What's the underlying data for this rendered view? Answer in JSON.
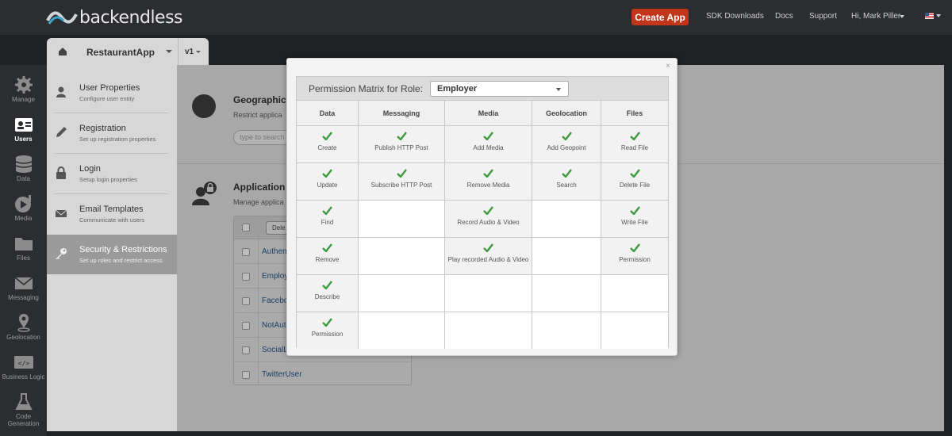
{
  "topbar": {
    "brand": "backendless",
    "create_app": "Create App",
    "links": [
      "SDK Downloads",
      "Docs",
      "Support",
      "Hi, Mark Piller"
    ],
    "accent": "#c3351b"
  },
  "app_selector": {
    "app_name": "RestaurantApp",
    "version": "v1"
  },
  "left_nav": [
    {
      "label": "Manage",
      "icon": "gear-icon"
    },
    {
      "label": "Users",
      "icon": "users-icon",
      "active": true
    },
    {
      "label": "Data",
      "icon": "database-icon"
    },
    {
      "label": "Media",
      "icon": "media-icon"
    },
    {
      "label": "Files",
      "icon": "folder-icon"
    },
    {
      "label": "Messaging",
      "icon": "envelope-icon"
    },
    {
      "label": "Geolocation",
      "icon": "location-pin-icon"
    },
    {
      "label": "Business Logic",
      "icon": "code-icon"
    },
    {
      "label": "Code Generation",
      "icon": "flask-icon"
    }
  ],
  "user_menu": [
    {
      "title": "User Properties",
      "desc": "Configure user entity",
      "icon": "user-icon"
    },
    {
      "title": "Registration",
      "desc": "Set up registration properties",
      "icon": "pen-icon"
    },
    {
      "title": "Login",
      "desc": "Setup login properties",
      "icon": "lock-icon"
    },
    {
      "title": "Email Templates",
      "desc": "Communicate with users",
      "icon": "envelope-icon"
    },
    {
      "title": "Security & Restrictions",
      "desc": "Set up roles and restrict access",
      "icon": "key-icon",
      "active": true
    }
  ],
  "main": {
    "geo_title": "Geographic",
    "geo_desc": "Restrict applica",
    "search_placeholder": "type to search",
    "roles_title": "Application",
    "roles_desc": "Manage applica",
    "delete_label": "Dele",
    "role_rows": [
      "Authen",
      "Employ",
      "Facebo",
      "NotAuth",
      "SocialL",
      "TwitterUser"
    ]
  },
  "modal": {
    "close": "×",
    "heading": "Permission Matrix for Role:",
    "selected_role": "Employer",
    "check_color": "#3e9a3e",
    "columns": [
      {
        "name": "Data",
        "items": [
          "Create",
          "Update",
          "Find",
          "Remove",
          "Describe",
          "Permission"
        ]
      },
      {
        "name": "Messaging",
        "items": [
          "Publish HTTP Post",
          "Subscribe HTTP Post"
        ]
      },
      {
        "name": "Media",
        "items": [
          "Add Media",
          "Remove Media",
          "Record Audio & Video",
          "Play recorded Audio & Video"
        ]
      },
      {
        "name": "Geolocation",
        "items": [
          "Add Geopoint",
          "Search"
        ]
      },
      {
        "name": "Files",
        "items": [
          "Read File",
          "Delete File",
          "Write File",
          "Permission"
        ]
      }
    ]
  }
}
